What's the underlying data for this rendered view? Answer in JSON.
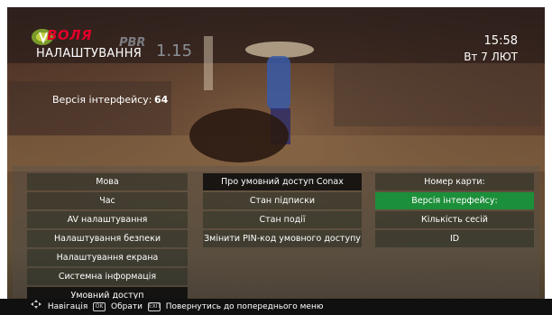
{
  "header": {
    "brand": "ВОЛЯ",
    "title": "НАЛАШТУВАННЯ",
    "channel_number": "1.15",
    "channel_logo": "PBR",
    "time": "15:58",
    "date": "Вт 7 ЛЮТ"
  },
  "info": {
    "version_label": "Версія інтерфейсу:",
    "version_value": "64"
  },
  "menu": {
    "col1": [
      {
        "label": "Мова"
      },
      {
        "label": "Час"
      },
      {
        "label": "AV налаштування"
      },
      {
        "label": "Налаштування безпеки"
      },
      {
        "label": "Налаштування екрана"
      },
      {
        "label": "Системна інформація"
      },
      {
        "label": "Умовний доступ"
      }
    ],
    "col2": [
      {
        "label": "Про умовний доступ Conax"
      },
      {
        "label": "Стан підписки"
      },
      {
        "label": "Стан події"
      },
      {
        "label": "Змінити PIN-код умовного доступу"
      }
    ],
    "col3": [
      {
        "label": "Номер карти:"
      },
      {
        "label": "Версія інтерфейсу:"
      },
      {
        "label": "Кількість сесій"
      },
      {
        "label": "ID"
      }
    ]
  },
  "statusbar": {
    "nav_label": "Навігація",
    "ok_key": "OK",
    "select_label": "Обрати",
    "back_key": "EXIT",
    "back_label": "Повернутись до попереднього меню"
  },
  "colors": {
    "brand_red": "#e0002a",
    "active_green": "#1c8f3a"
  }
}
